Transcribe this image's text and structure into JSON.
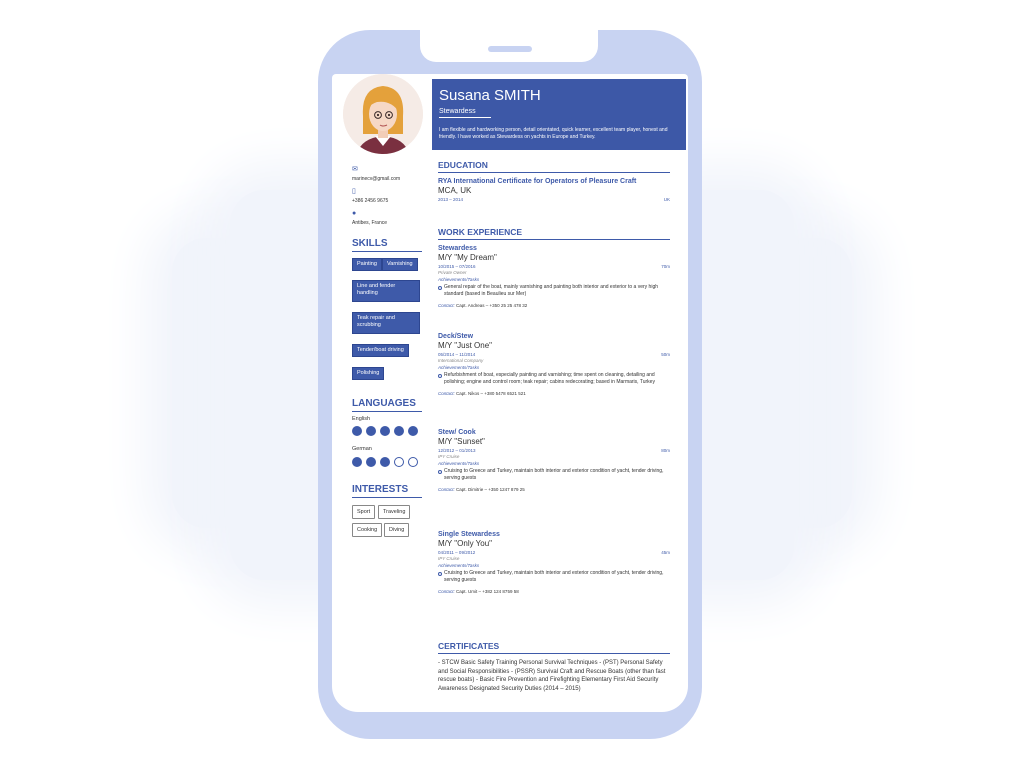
{
  "profile": {
    "name": "Susana SMITH",
    "role": "Stewardess",
    "summary": "I am flexible and hardworking person, detail orientated, quick learner, excellent team player, honest and friendly. I have worked as Stewardess on yachts in Europe and Turkey.",
    "email": "marinecv@gmail.com",
    "phone": "+386 2456 9675",
    "location": "Antibes, France"
  },
  "icons": {
    "email": "envelope-icon",
    "phone": "mobile-phone-icon",
    "location": "map-pin-icon"
  },
  "colors": {
    "accent": "#3e5aa9",
    "header": "#3d58a7",
    "phone_frame": "#c8d3f2"
  },
  "skills": {
    "title": "SKILLS",
    "items": [
      "Painting",
      "Varnishing",
      "Line and fender handling",
      "Teak repair and scrubbing",
      "Tender/boat driving",
      "Polishing"
    ]
  },
  "languages": {
    "title": "LANGUAGES",
    "items": [
      {
        "name": "English",
        "level": 5,
        "max": 5
      },
      {
        "name": "German",
        "level": 3,
        "max": 5
      }
    ]
  },
  "interests": {
    "title": "INTERESTS",
    "items": [
      "Sport",
      "Traveling",
      "Cooking",
      "Diving"
    ]
  },
  "education": {
    "title": "EDUCATION",
    "items": [
      {
        "degree": "RYA International Certificate for Operators of Pleasure Craft",
        "school": "MCA, UK",
        "dates": "2013 – 2014",
        "place": "UK"
      }
    ]
  },
  "work": {
    "title": "WORK EXPERIENCE",
    "achievements_label": "Achievements/Tasks",
    "contact_label": "Contact:",
    "items": [
      {
        "title": "Stewardess",
        "vessel": "M/Y \"My Dream\"",
        "dates": "10/2015 – 07/2016",
        "length": "70m",
        "owner": "Private Owner",
        "task": "General repair of the boat, mainly varnishing and painting both interior and exterior to a very high standard (based in Beaulieu sur Mer)",
        "contact": "Capt. Andreas – +350 25 25 478 32"
      },
      {
        "title": "Deck/Stew",
        "vessel": "M/Y \"Just One\"",
        "dates": "05/2014 – 11/2014",
        "length": "50m",
        "owner": "International Company",
        "task": "Refurbishment of boat, especially painting and varnishing; time spent on cleaning, detailing and polishing; engine and control room; teak repair; cabins redecorating; based in Marmaris, Turkey",
        "contact": "Capt. Nikos – +380 5478 6521 521"
      },
      {
        "title": "Stew/ Cook",
        "vessel": "M/Y \"Sunset\"",
        "dates": "12/2012 – 01/2013",
        "length": "80m",
        "owner": "IPY Cruise",
        "task": "Cruising to Greece and Turkey, maintain both interior and exterior condition of yacht, tender driving, serving guests",
        "contact": "Capt. Dimitrie – +350 1247 879 25"
      },
      {
        "title": "Single Stewardess",
        "vessel": "M/Y \"Only You\"",
        "dates": "04/2011 – 09/2012",
        "length": "45m",
        "owner": "IPY Cruise",
        "task": "Cruising to Greece and Turkey, maintain both interior and exterior condition of yacht, tender driving, serving guests",
        "contact": "Capt. Umit – +382 124 8759 58"
      }
    ]
  },
  "certificates": {
    "title": "CERTIFICATES",
    "text": "- STCW Basic Safety Training Personal Survival Techniques - (PST) Personal Safety and Social Responsibilities - (PSSR) Survival Craft and Rescue Boats (other than fast rescue boats) - Basic Fire Prevention and Firefighting Elementary First Aid Security Awareness Designated Security Duties (2014 – 2015)"
  }
}
